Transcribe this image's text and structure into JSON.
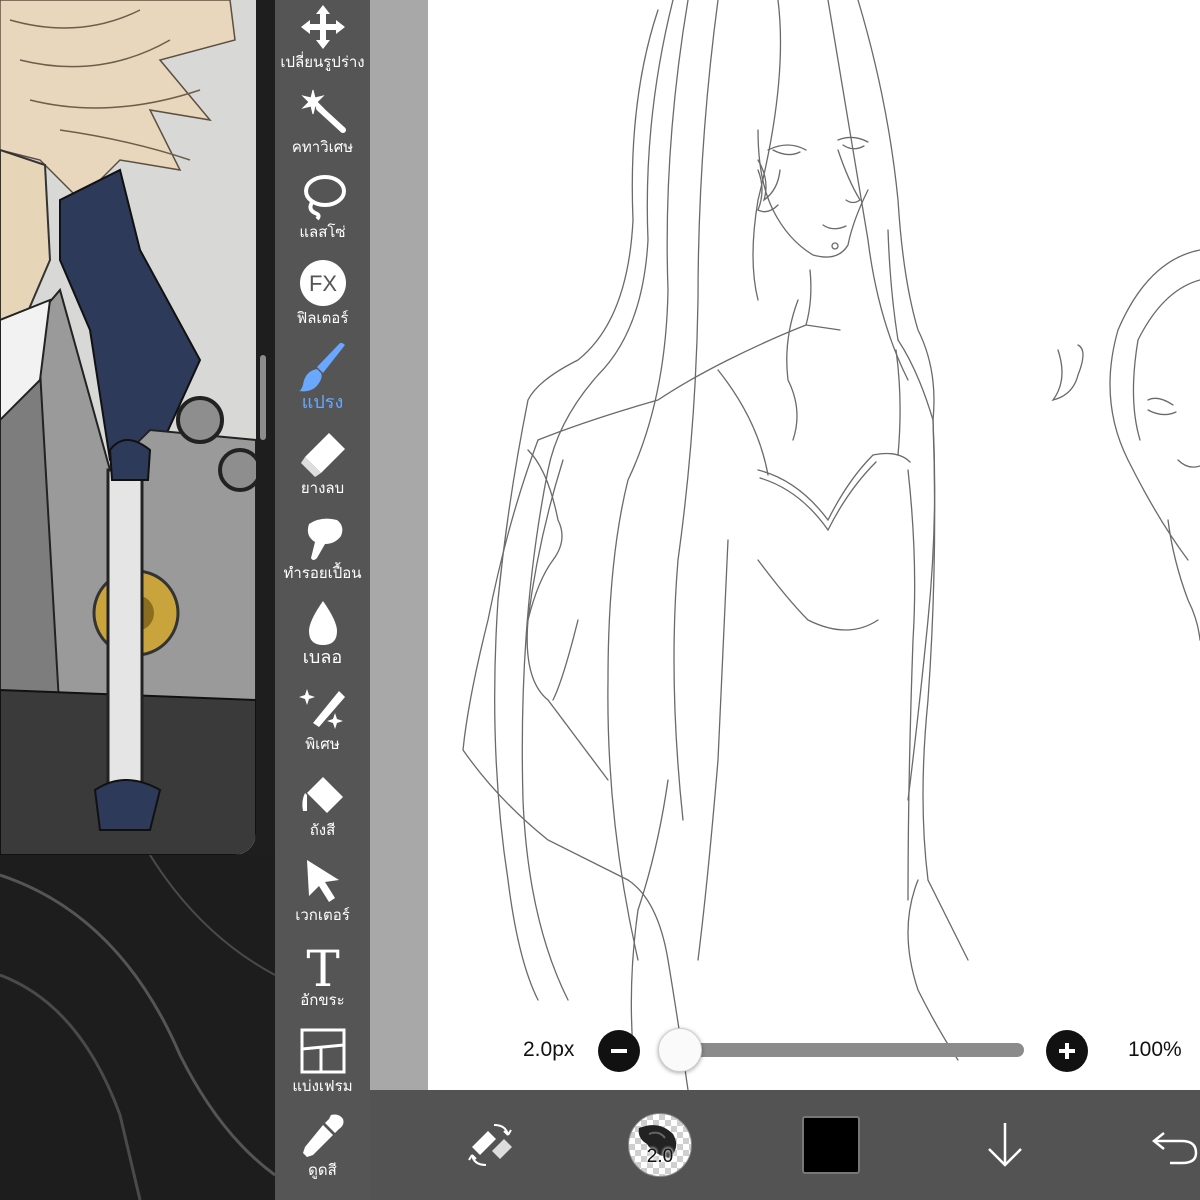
{
  "toolbar": {
    "tools": [
      {
        "label": "เปลี่ยนรูปร่าง",
        "icon": "transform-icon"
      },
      {
        "label": "คทาวิเศษ",
        "icon": "magic-wand-icon"
      },
      {
        "label": "แลสโซ่",
        "icon": "lasso-icon"
      },
      {
        "label": "ฟิลเตอร์",
        "icon": "filter-fx-icon",
        "icon_text": "FX"
      },
      {
        "label": "แปรง",
        "icon": "brush-icon",
        "active": true
      },
      {
        "label": "ยางลบ",
        "icon": "eraser-icon"
      },
      {
        "label": "ทำรอยเปื้อน",
        "icon": "smudge-icon"
      },
      {
        "label": "เบลอ",
        "icon": "blur-drop-icon"
      },
      {
        "label": "พิเศษ",
        "icon": "special-sparkle-icon"
      },
      {
        "label": "ถังสี",
        "icon": "fill-bucket-icon"
      },
      {
        "label": "เวกเตอร์",
        "icon": "vector-cursor-icon"
      },
      {
        "label": "อักขระ",
        "icon": "text-icon",
        "icon_text": "T"
      },
      {
        "label": "แบ่งเฟรม",
        "icon": "frame-divider-icon"
      },
      {
        "label": "ดูดสี",
        "icon": "eyedropper-icon"
      }
    ],
    "active_color": "#6aa7ff"
  },
  "brush_size": {
    "value_label": "2.0px",
    "slider_fraction": 0.0
  },
  "zoom": {
    "label": "100%"
  },
  "bottom_bar": {
    "brush_size_badge": "2.0",
    "current_color": "#000000",
    "icons": [
      "swap-tools-icon",
      "brush-preview",
      "color-swatch",
      "save-arrow-icon",
      "undo-icon"
    ]
  }
}
